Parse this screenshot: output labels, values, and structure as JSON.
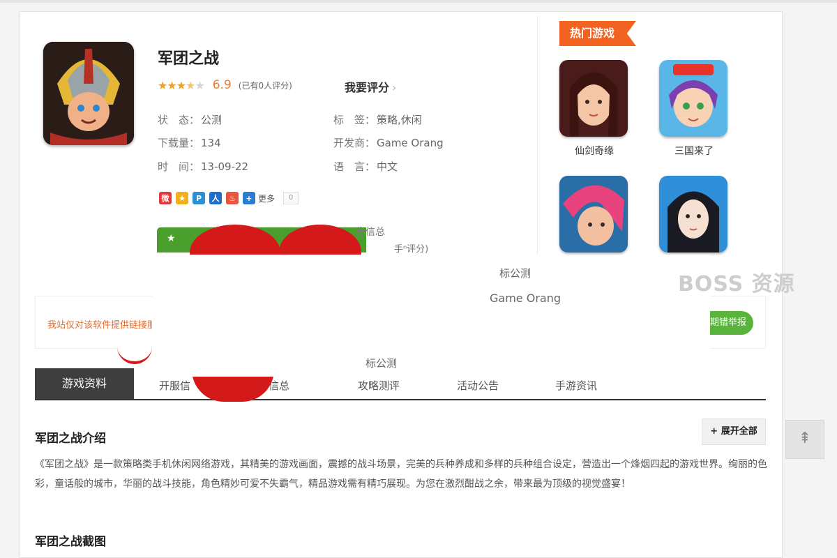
{
  "app": {
    "title": "军团之战",
    "stars": "★★★",
    "half_star": "★",
    "empty_stars": "★",
    "score": "6.9",
    "score_count": "(已有0人评分)",
    "rate_label": "我要评分",
    "rate_arrow": "›",
    "rating_fraction": 0.69
  },
  "info": {
    "status_key": "状　态：",
    "status_val": "公测",
    "downloads_key": "下载量：",
    "downloads_val": "134",
    "time_key": "时　间：",
    "time_val": "13-09-22",
    "tags_key": "标　签：",
    "tags_val": "策略,休闲",
    "dev_key": "开发商：",
    "dev_val": "Game Orang",
    "lang_key": "语　言：",
    "lang_val": "中文"
  },
  "share": {
    "more": "更多",
    "count": "0"
  },
  "ghost": {
    "t1": "告信总",
    "t2": "手ⁿ评分)",
    "t3": "标公测",
    "t4": "Game Orang",
    "t5": "标公测"
  },
  "notice": {
    "text": "我站仅对该软件提供链接服",
    "report": "期错举报"
  },
  "watermark": "BOSS 资源",
  "hot": {
    "title": "热门游戏",
    "games": [
      {
        "name": "仙剑奇缘"
      },
      {
        "name": "三国来了"
      },
      {
        "name": ""
      },
      {
        "name": ""
      }
    ]
  },
  "tabs": {
    "active": "游戏资料",
    "t2": "开服信",
    "t3": "告信总",
    "t4": "攻略测评",
    "t5": "活动公告",
    "t6": "手游资讯"
  },
  "intro": {
    "title": "军团之战介绍",
    "expand": "+ 展开全部",
    "text": "《军团之战》是一款策略类手机休闲网络游戏，其精美的游戏画面，震撼的战斗场景，完美的兵种养成和多样的兵种组合设定，营造出一个烽烟四起的游戏世界。绚丽的色彩，童话般的城市，华丽的战斗技能，角色精妙可爱不失霸气，精品游戏需有精巧展现。为您在激烈酣战之余，带来最为顶级的视觉盛宴！"
  },
  "screens": {
    "title": "军团之战截图"
  },
  "totop": {
    "icon": "to-top-icon"
  }
}
